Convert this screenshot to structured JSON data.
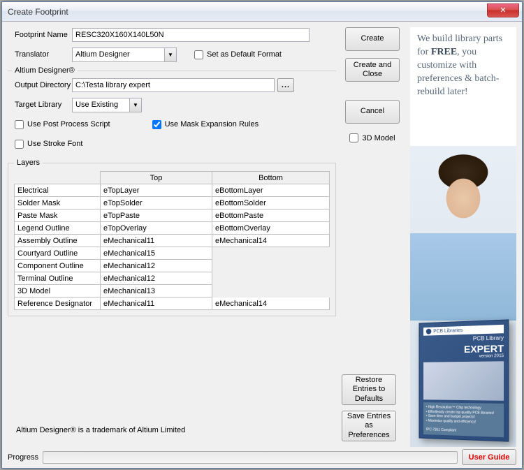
{
  "window": {
    "title": "Create Footprint",
    "close_glyph": "✕"
  },
  "fields": {
    "footprint_name_label": "Footprint Name",
    "footprint_name_value": "RESC320X160X140L50N",
    "translator_label": "Translator",
    "translator_value": "Altium Designer",
    "set_default_label": "Set as Default Format",
    "group_label": "Altium Designer®",
    "output_dir_label": "Output Directory",
    "output_dir_value": "C:\\Testa library expert",
    "target_lib_label": "Target Library",
    "target_lib_value": "Use Existing",
    "use_post_process_label": "Use Post Process Script",
    "use_mask_label": "Use Mask Expansion Rules",
    "use_stroke_label": "Use Stroke Font",
    "threeD_label": "3D Model"
  },
  "buttons": {
    "create": "Create",
    "create_close": "Create and Close",
    "cancel": "Cancel",
    "restore": "Restore Entries to Defaults",
    "save_prefs": "Save Entries as Preferences",
    "user_guide": "User Guide",
    "browse": "..."
  },
  "layers": {
    "legend": "Layers",
    "headers": {
      "top": "Top",
      "bottom": "Bottom"
    },
    "rows": [
      {
        "name": "Electrical",
        "top": "eTopLayer",
        "bottom": "eBottomLayer"
      },
      {
        "name": "Solder Mask",
        "top": "eTopSolder",
        "bottom": "eBottomSolder"
      },
      {
        "name": "Paste Mask",
        "top": "eTopPaste",
        "bottom": "eBottomPaste"
      },
      {
        "name": "Legend Outline",
        "top": "eTopOverlay",
        "bottom": "eBottomOverlay"
      },
      {
        "name": "Assembly Outline",
        "top": "eMechanical11",
        "bottom": "eMechanical14"
      },
      {
        "name": "Courtyard Outline",
        "top": "eMechanical15",
        "bottom": ""
      },
      {
        "name": "Component Outline",
        "top": "eMechanical12",
        "bottom": ""
      },
      {
        "name": "Terminal Outline",
        "top": "eMechanical12",
        "bottom": ""
      },
      {
        "name": "3D Model",
        "top": "eMechanical13",
        "bottom": ""
      },
      {
        "name": "Reference Designator",
        "top": "eMechanical11",
        "bottom": "eMechanical14"
      }
    ]
  },
  "footer": {
    "trademark": "Altium Designer® is a trademark of Altium Limited",
    "progress_label": "Progress"
  },
  "ad": {
    "line1": "We build library parts for ",
    "bold1": "FREE",
    "line2": ", you customize with preferences & batch-rebuild later!",
    "product_brand": "PCB Libraries",
    "product_line": "PCB Library",
    "product_name": "EXPERT",
    "product_version": "version 2015",
    "compliant": "IPC-7351 Compliant"
  }
}
